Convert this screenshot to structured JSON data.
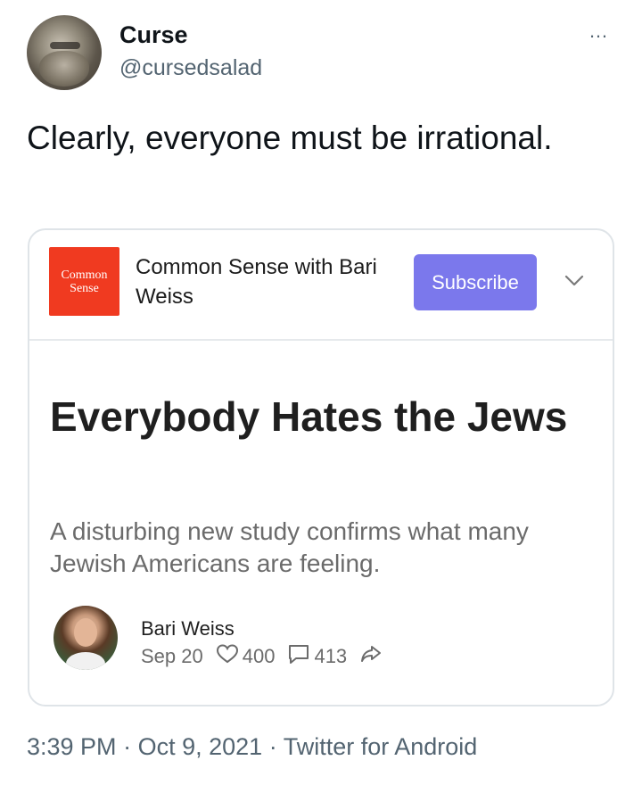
{
  "author": {
    "display_name": "Curse",
    "handle": "@cursedsalad"
  },
  "more_icon": "…",
  "tweet": {
    "text": "Clearly, everyone must be irrational."
  },
  "card": {
    "logo_text": [
      "Common",
      "Sense"
    ],
    "logo_color": "#f03a20",
    "publication_name": "Common Sense with Bari Weiss",
    "subscribe_label": "Subscribe",
    "subscribe_color": "#7b78ec",
    "headline": "Everybody Hates the Jews",
    "subtitle": "A disturbing new study confirms what many Jewish Americans are feeling.",
    "post_author": "Bari Weiss",
    "post_date": "Sep 20",
    "likes": "400",
    "comments": "413"
  },
  "footer": {
    "time": "3:39 PM",
    "date": "Oct 9, 2021",
    "source": "Twitter for Android",
    "separator": "·"
  }
}
